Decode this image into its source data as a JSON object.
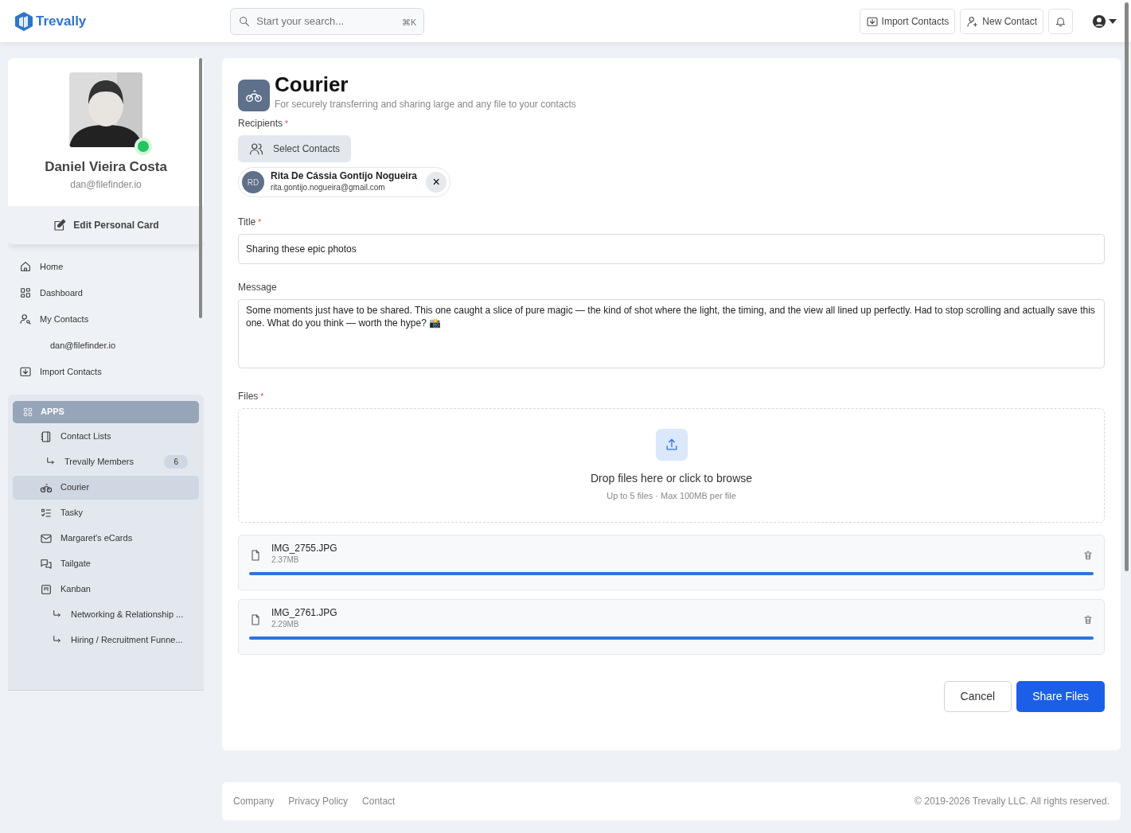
{
  "topbar": {
    "brand": "Trevally",
    "search": {
      "placeholder": "Start your search...",
      "shortcut": "⌘K"
    },
    "buttons": [
      "Import Contacts",
      "New Contact"
    ]
  },
  "profile": {
    "name": "Daniel Vieira Costa",
    "email": "dan@filefinder.io",
    "online": true,
    "edit_label": "Edit Personal Card"
  },
  "nav": [
    {
      "label": "Home"
    },
    {
      "label": "Dashboard"
    },
    {
      "label": "My Contacts",
      "children": [
        {
          "label": "dan@filefinder.io"
        }
      ]
    },
    {
      "label": "Import Contacts"
    }
  ],
  "apps": {
    "title": "APPS",
    "items": [
      {
        "label": "Contact Lists",
        "selected": false,
        "children": [
          {
            "label": "Trevally Members",
            "count": "6"
          }
        ]
      },
      {
        "label": "Courier",
        "selected": true
      },
      {
        "label": "Tasky",
        "selected": false
      },
      {
        "label": "Margaret's eCards",
        "selected": false
      },
      {
        "label": "Tailgate",
        "selected": false
      },
      {
        "label": "Kanban",
        "selected": false,
        "children": [
          {
            "label": "Networking & Relationship ..."
          },
          {
            "label": "Hiring / Recruitment Funne..."
          }
        ]
      }
    ]
  },
  "page": {
    "title": "Courier",
    "subtitle": "For securely transferring and sharing large and any file to your contacts"
  },
  "recipients": {
    "label": "Recipients",
    "asterisk": "*",
    "button": "Select Contacts",
    "chips": [
      {
        "initials": "RD",
        "name": "Rita De Cássia Gontijo Nogueira",
        "email": "rita.gontijo.nogueira@gmail.com",
        "remove": "×"
      }
    ]
  },
  "title_field": {
    "label": "Title",
    "asterisk": "*",
    "value": "Sharing these epic photos"
  },
  "message_field": {
    "label": "Message",
    "value": "Some moments just have to be shared. This one caught a slice of pure magic — the kind of shot where the light, the timing, and the view all lined up perfectly. Had to stop scrolling and actually save this one. What do you think — worth the hype? 📸"
  },
  "files": {
    "label": "Files",
    "asterisk": "*",
    "drop_title": "Drop files here or click to browse",
    "drop_hint": "Up to 5 files · Max 100MB per file",
    "items": [
      {
        "name": "IMG_2755.JPG",
        "size": "2.37MB",
        "level": 1
      },
      {
        "name": "IMG_2761.JPG",
        "size": "2.29MB",
        "level": 1
      }
    ]
  },
  "actions": {
    "cancel": "Cancel",
    "submit": "Share Files"
  },
  "footer": {
    "links": [
      "Company",
      "Privacy Policy",
      "Contact"
    ],
    "copyright": "© 2019-2026 Trevally LLC. All rights reserved."
  }
}
